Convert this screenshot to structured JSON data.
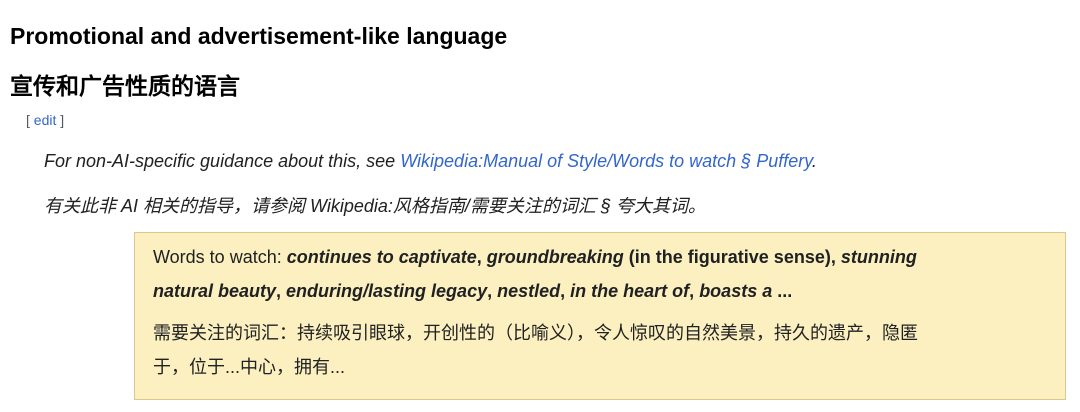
{
  "section": {
    "heading_en": "Promotional and advertisement-like language",
    "heading_zh": "宣传和广告性质的语言",
    "edit": {
      "open": "[ ",
      "label": "edit",
      "close": " ]"
    }
  },
  "hatnote_en": {
    "prefix": "For non-AI-specific guidance about this, see ",
    "link": "Wikipedia:Manual of Style/Words to watch § Puffery",
    "suffix": "."
  },
  "hatnote_zh": {
    "text": "有关此非 AI 相关的指导，请参阅 Wikipedia:风格指南/需要关注的词汇 § 夸大其词。"
  },
  "box": {
    "line1": {
      "lead": "Words to watch: ",
      "w1": "continues to captivate",
      "s1": ", ",
      "w2": "groundbreaking",
      "note": " (in the figurative sense), ",
      "w3": "stunning"
    },
    "line2": {
      "w1": "natural beauty",
      "s1": ", ",
      "w2": "enduring/lasting legacy",
      "s2": ", ",
      "w3": "nestled",
      "s3": ", ",
      "w4": "in the heart of",
      "s4": ", ",
      "w5": "boasts a",
      "ellipsis": "  ..."
    },
    "zh_line1": "需要关注的词汇：持续吸引眼球，开创性的（比喻义），令人惊叹的自然美景，持久的遗产，隐匿",
    "zh_line2": "于，位于...中心，拥有..."
  },
  "colors": {
    "link": "#3366cc",
    "box_background": "#fcf0c1",
    "box_border": "#ddc78b",
    "text": "#202122"
  }
}
